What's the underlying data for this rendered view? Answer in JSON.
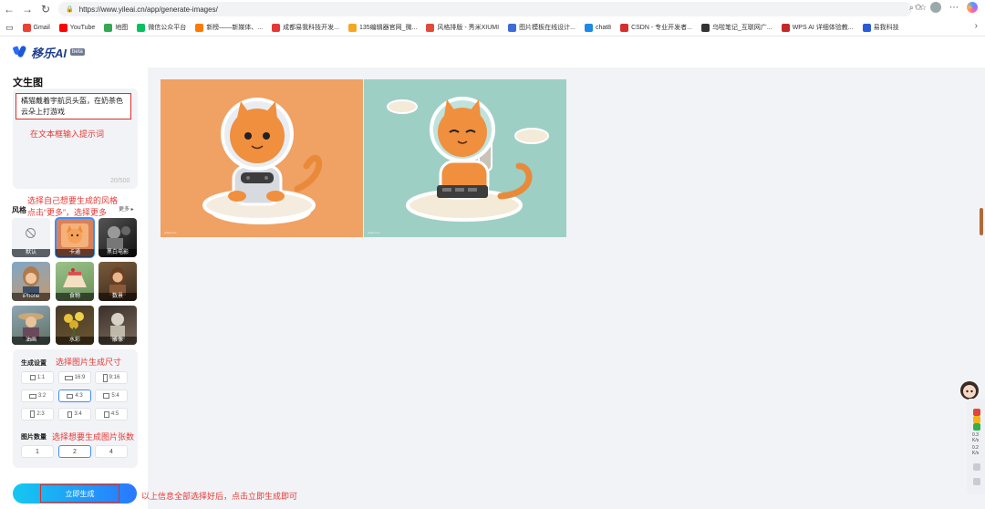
{
  "browser": {
    "url": "https://www.yileai.cn/app/generate-images/",
    "bookmarks": [
      "Gmail",
      "YouTube",
      "地图",
      "微信公众平台",
      "新榜——新媒体、...",
      "成都易我科技开发...",
      "135编辑器官网_微...",
      "风格排版 - 秀米XIUMI",
      "图片模板在线设计...",
      "chat8",
      "CSDN - 专业开发者...",
      "乌啦笔记_互联网广...",
      "WPS AI 详细体验教...",
      "易我科技"
    ]
  },
  "app": {
    "logo_text": "移乐AI",
    "beta_badge": "beta"
  },
  "panel": {
    "title": "文生图",
    "prompt_value": "橘猫戴着宇航员头盔，在奶茶色云朵上打游戏",
    "prompt_hint": "在文本框输入提示词",
    "counter": "20/500",
    "style_hint_1": "选择自己想要生成的风格",
    "style_hint_2": "点击“更多”，选择更多",
    "style_label": "风格",
    "more_link": "更多 ▸",
    "styles": [
      {
        "label": "默认"
      },
      {
        "label": "卡通"
      },
      {
        "label": "黑白电影"
      },
      {
        "label": "iPhone"
      },
      {
        "label": "食物"
      },
      {
        "label": "数景"
      },
      {
        "label": "油画"
      },
      {
        "label": "水彩"
      },
      {
        "label": "雕像"
      }
    ],
    "settings_label": "生成设置",
    "settings_hint": "选择图片生成尺寸",
    "ratios": [
      "1:1",
      "16:9",
      "9:16",
      "3:2",
      "4:3",
      "5:4",
      "2:3",
      "3:4",
      "4:5"
    ],
    "selected_ratio": "4:3",
    "count_label": "图片数量",
    "count_hint": "选择想要生成图片张数",
    "counts": [
      "1",
      "2",
      "4"
    ],
    "selected_count": "2",
    "generate_button": "立即生成",
    "generate_hint": "以上信息全部选择好后，点击立即生成即可"
  },
  "results": [
    {
      "alt": "orange cat astronaut gaming on cloud, orange background",
      "watermark": "yileai.com"
    },
    {
      "alt": "orange cat astronaut gaming on cloud, teal background",
      "watermark": "yileai.com"
    }
  ],
  "float_bar": {
    "stat1": "0.3",
    "stat1_unit": "K/s",
    "stat2": "0.2",
    "stat2_unit": "K/s"
  },
  "colors": {
    "accent": "#2a78ff",
    "annotation_red": "#e53935",
    "image1_bg": "#f0a164",
    "image2_bg": "#9ecfc4"
  }
}
